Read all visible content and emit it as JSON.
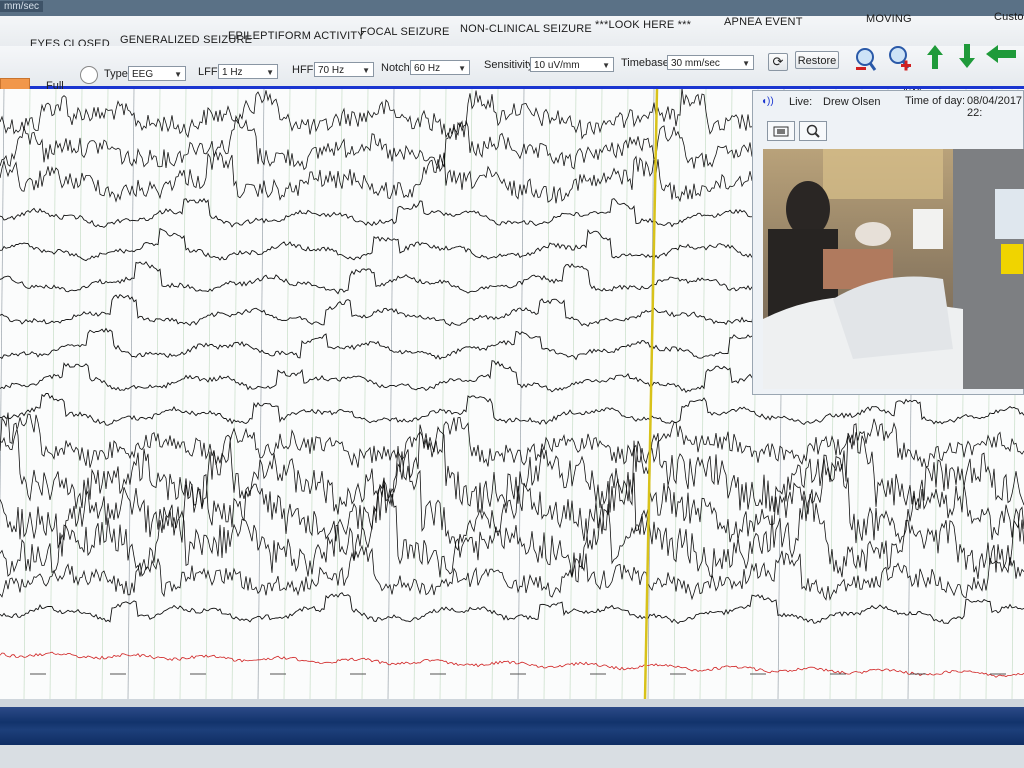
{
  "window": {
    "title_fragment": "mm/sec"
  },
  "event_buttons": [
    "EYES CLOSED",
    "GENERALIZED SEIZURE",
    "EPILEPTIFORM ACTIVITY",
    "FOCAL SEIZURE",
    "NON-CLINICAL SEIZURE",
    "***LOOK HERE ***",
    "APNEA EVENT",
    "MOVING",
    "Custo"
  ],
  "toolbar": {
    "full_label": "Full",
    "type_label": "Type",
    "type_value": "EEG",
    "lff_label": "LFF",
    "lff_value": "1 Hz",
    "hff_label": "HFF",
    "hff_value": "70 Hz",
    "notch_label": "Notch",
    "notch_value": "60 Hz",
    "sensitivity_label": "Sensitivity",
    "sensitivity_value": "10 uV/mm",
    "timebase_label": "Timebase",
    "timebase_value": "30 mm/sec",
    "restore_label": "Restore"
  },
  "video": {
    "live_label": "Live:",
    "patient_name": "Drew Olsen",
    "time_label": "Time of day:",
    "date_time": "08/04/2017 22:"
  },
  "colors": {
    "accent_blue": "#1a35d0",
    "cursor_yellow": "#d8c21a",
    "reference_red": "#d02020",
    "orange": "#f1974a",
    "arrow_green": "#1f9a3a"
  },
  "icons": [
    "zoom-out-icon",
    "zoom-in-icon",
    "arrow-up-icon",
    "arrow-down-icon",
    "arrow-left-icon",
    "refresh-icon",
    "snapshot-icon",
    "video-zoom-icon",
    "speaker-icon"
  ]
}
